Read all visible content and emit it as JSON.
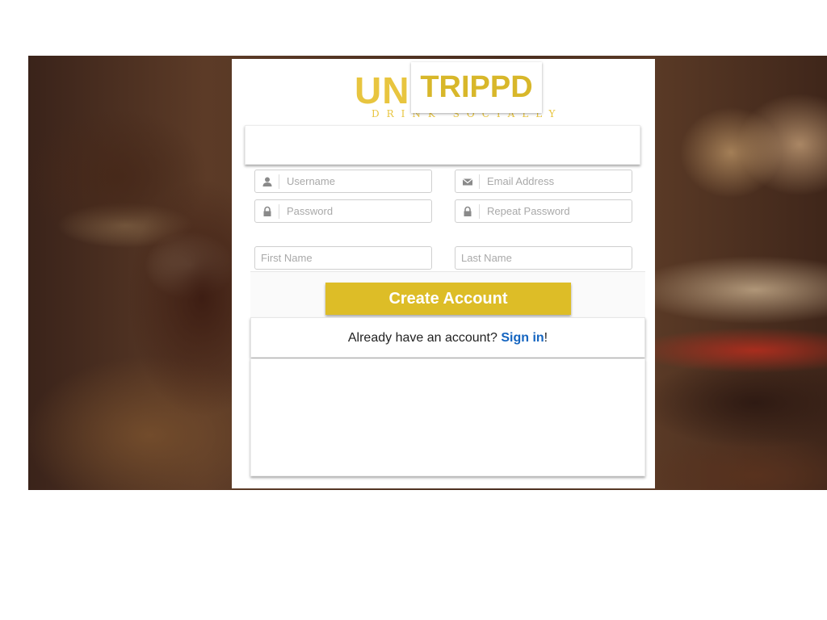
{
  "logo": {
    "prefix": "UN",
    "tagline": "DRINK SOCIALLY",
    "highlight": "TRIPPD",
    "brand_color": "#e8c53f"
  },
  "form": {
    "username": {
      "placeholder": "Username",
      "value": "",
      "icon": "user-icon"
    },
    "email": {
      "placeholder": "Email Address",
      "value": "",
      "icon": "envelope-icon"
    },
    "password": {
      "placeholder": "Password",
      "value": "",
      "icon": "lock-icon"
    },
    "repeat_password": {
      "placeholder": "Repeat Password",
      "value": "",
      "icon": "lock-icon"
    },
    "first_name": {
      "placeholder": "First Name",
      "value": ""
    },
    "last_name": {
      "placeholder": "Last Name",
      "value": ""
    },
    "submit_label": "Create Account",
    "submit_color": "#ddbd27"
  },
  "signin": {
    "prompt": "Already have an account?",
    "link": "Sign in",
    "suffix": "!",
    "link_color": "#1565c0"
  }
}
